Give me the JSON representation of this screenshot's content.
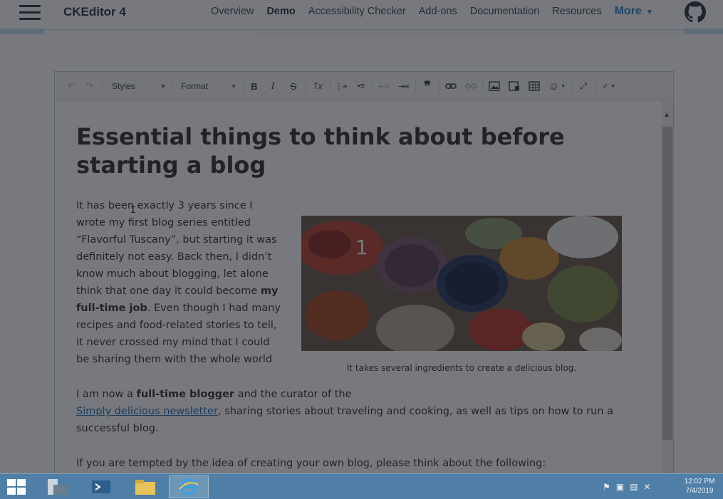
{
  "nav": {
    "brand": "CKEditor 4",
    "links": [
      "Overview",
      "Demo",
      "Accessibility Checker",
      "Add-ons",
      "Documentation",
      "Resources"
    ],
    "more_label": "More",
    "more_caret": "▼"
  },
  "toolbar": {
    "styles_label": "Styles",
    "format_label": "Format",
    "bold": "B",
    "italic": "I",
    "strike": "S",
    "remove_format": "Tx",
    "blockquote": "❞"
  },
  "content": {
    "title": "Essential things to think about before starting a blog",
    "para1_a": "It has been exactly 3 years since I wrote my first blog series entitled “Flavorful Tuscany”, but starting it was definitely not easy. Back then, I didn’t know much about blogging, let alone think that one day it could become ",
    "para1_bold": "my full-time job",
    "para1_b": ". Even though I had many recipes and food-related stories to tell, it never crossed my mind that I could be sharing them with the whole world",
    "para2_a": "I am now a ",
    "para2_bold": "full-time blogger",
    "para2_b": " and the curator of the ",
    "para2_link": "Simply delicious newsletter",
    "para2_c": ", sharing stories about traveling and cooking, as well as tips on how to run a successful blog.",
    "para3": "If you are tempted by the idea of creating your own blog, please think about the following:",
    "figure_number": "1",
    "caption": "It takes several ingredients to create a delicious blog."
  },
  "taskbar": {
    "time": "12:02 PM",
    "date": "7/4/2019"
  },
  "colors": {
    "accent": "#2d82c8",
    "taskbar": "#4f7fa6"
  }
}
